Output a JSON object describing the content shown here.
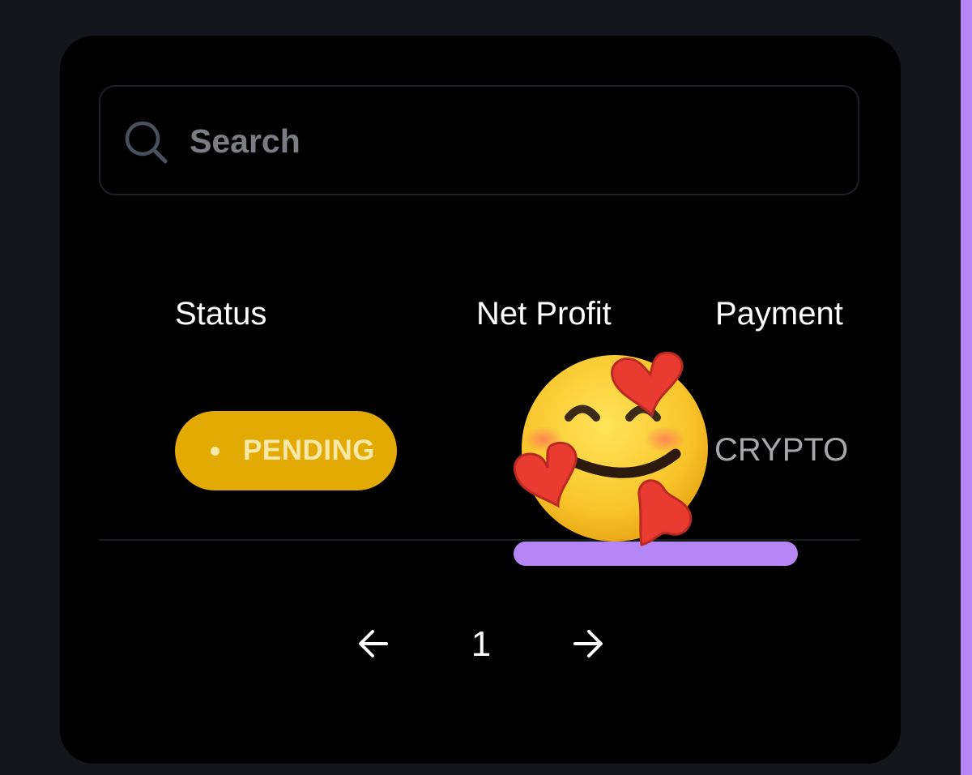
{
  "search": {
    "placeholder": "Search",
    "icon": "search-icon"
  },
  "table": {
    "columns": [
      "Status",
      "Net Profit",
      "Payment"
    ],
    "rows": [
      {
        "status": "PENDING",
        "net_profit": "",
        "payment": "CRYPTO"
      }
    ]
  },
  "pagination": {
    "prev_icon": "arrow-left-icon",
    "current_page": "1",
    "next_icon": "arrow-right-icon"
  },
  "colors": {
    "accent": "#b487f5",
    "pending_badge": "#e3aa05",
    "card_background": "#000000",
    "page_background": "#15161b"
  },
  "overlay": {
    "sticker": "smiling-face-with-hearts-emoji"
  }
}
